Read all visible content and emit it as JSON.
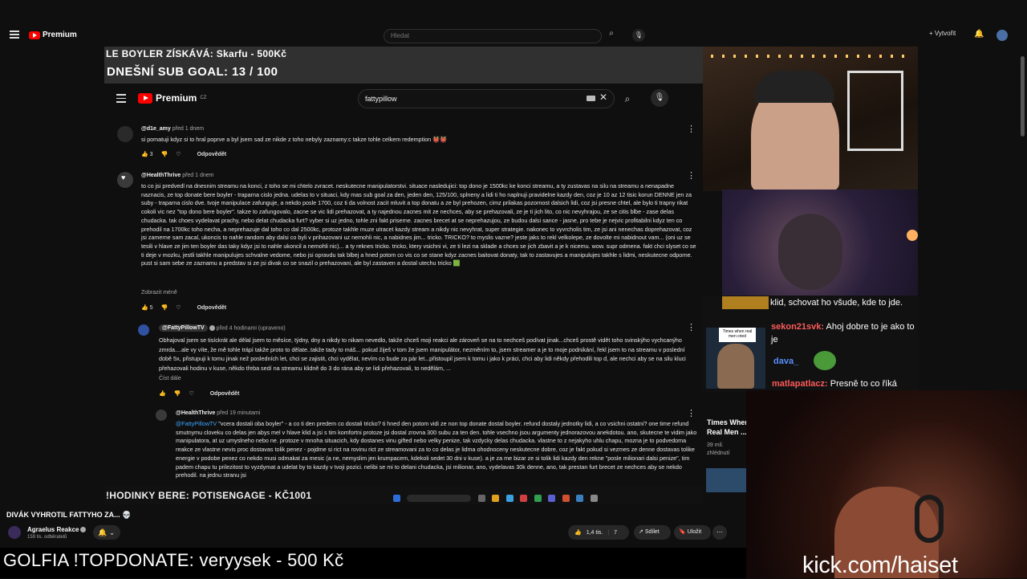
{
  "outer": {
    "logo": "Premium",
    "search_placeholder": "Hledat",
    "create": "+ Vytvořit"
  },
  "overlay": {
    "goal_line1": "LE BOYLER ZÍSKÁVÁ: Skarfu - 500Kč",
    "goal_line2": "DNEŠNÍ SUB GOAL: 13 / 100",
    "ticker": "!HODINKY BERE: POTISENGAGE - KČ1001",
    "topdonate": "GOLFIA !TOPDONATE: veryysek - 500 Kč",
    "kick": "kick.com/haiset"
  },
  "inner": {
    "logo": "Premium",
    "logo_cc": "CZ",
    "search_value": "fattypillow"
  },
  "comments": [
    {
      "handle": "@d1e_amy",
      "time": "před 1 dnem",
      "text": "si pomatuji kdyz si to hral poprve a byl jsem sad ze nikde z toho nebyly zaznamy:c takze tohle celkem redemption 👹👹",
      "likes": "3",
      "reply": "Odpovědět"
    },
    {
      "handle": "@HealthThrive",
      "time": "před 1 dnem",
      "text": "to co jsi predvedl na dnesnim streamu na konci, z toho se mi chtelo zvracet. neskutecne manipulatorstvi. situace nasledujici: top dono je 1500kc ke konci streamu, a ty zustavas na silu na streamu a nenapadne naznacis, ze top donate bere boyler - traparna cislo jedna. udelas to v situaci, kdy mas sub goal za den, jeden den, 125/100, splneny a lidi ti ho naplnuji pravidelne kazdy den, coz je 10 az 12 tisic korun DENNE jen za suby - traparna cislo dve. tvoje manipulace zafunguje, a nekdo posle 1700, coz ti da volnost zacit mluvit a top donatu a ze byl prehozen, cimz prilakas pozornost dalsich lidi, coz jsi presne chtel, ale bylo ti trapny rikat cokoli vic nez \"top dono bere boyler\". takze to zafungovalo, zacne se vic lidi prehazovat, a ty najednou zacnes mit ze nechces, aby se prehazovali, ze je ti jich lito, co nic nevyhrajou, ze se citis blbe - zase delas chudacka. tak choes vydelavat prachy, nebo delat chudacka furt? vyber si uz jedno, tohle zni fakt priserne. zacnes brecet at se neprehazujou, ze budou dalsi sance - jasne, pro tebe je nejvic profitabilni kdyz ten co prehodil na 1700kc toho necha, a neprehazuje dal toho co dal 2500kc, protoze takhle muze utracet kazdy stream a nikdy nic nevyhrat, super strategie. nakonec to vyvrcholis tim, ze jsi ani nenechas doprehazovat, coz jsi zamerne sam zacal, ukoncis to nahle random aby dalsi co byli v prihazovani uz nemohli nic, a nabidnes jim... tricko. TRICKO? to myslis vazne? jeste jaks to rekl velkolepe, ze dovolte mi nabidnout vam... (oni uz se tesili v hlave ze jim ten boyler das taky kdyz jsi to nahle ukoncil a nemohli nic)... a ty reknes tricko. tricko, ktery vsichni vi, ze ti lezi na sklade a chces se jich zbavit a je k nicemu. wow. supr odmena. fakt chci slyset co se ti deje v mozku, jestli takhle manipulujes schvalne vedome, nebo jsi opravdu tak blbej a hned potom co vis co se stane kdyz zacnes baitovat donaty, tak to zastavujes a manipulujes takhle s lidmi, neskutecne odporne. pust si sam sebe ze zaznamu a predstav si ze jsi divak co se snazil o prehazovani, ale byl zastaven a dostal utechu tricko 🟩",
      "show_less": "Zobrazit méně",
      "likes": "5",
      "reply": "Odpovědět"
    },
    {
      "handle": "@FattyPillowTV",
      "time": "před 4 hodinami (upraveno)",
      "text": "Obhajoval jsem se tisíckrát ale dělal jsem to měsíce, týdny, dny a nikdy to nikam nevedlo, takže chceš moji reakci ale zároveň se na to nechceš podívat jinak...chceš prostě vidět toho svinskýho vychcanýho zmrda....ale vy víte, že mě tohle trápí takže proto to dělate..takže tady to máš... pokud žiješ v tom že jsem manipulátor, nezměním to, jsem streamer a je to moje podnikání, řekl jsem to na streamu v poslední době 5x, přistupuji k tomu jinak než posledních let, chci se zajistit, chci vydělat, nevím co bude za pár let...přistoupil jsem k tomu i jako k práci, chci aby lidi někdy přehodili top d, ale nechci aby se na silu kluci přehazovali hodinu v kuse, někdo třeba sedí na streamu klidně do 3 do rána aby se lidi přehazovali, to nedělám, ...",
      "read_more": "Číst dále",
      "reply": "Odpovědět"
    },
    {
      "handle": "@HealthThrive",
      "time": "před 19 minutami",
      "mention": "@FattyPillowTV",
      "text": " \"vcera dostali oba boyler\" - a co ti den predem co dostali tricko? ti hned den potom vidi ze non top donate dostal boyler. refund dostaly jednotky lidi, a co vsichni ostatni? one time refund smutnymu cloveku co delas jen abys mel v hlave klid a jsi s tim komfortni protoze jsi dostal zrovna 300 subu za ten den. tohle vsechno jsou argumenty jednorazovou anekdotou. ano, skutecne te vidim jako manipulatora, at uz umyslneho nebo ne. protoze v mnoha situacich, kdy dostanes vinu gifted nebo velky penize, tak vzdycky delas chudacka. vlastne to z nejakyho uhlu chapu, mozna je to podvedoma reakce ze vlastne nevis proc dostavas tolik penez - pojdme si rict na rovinu rict ze streamovani za to co delas je lidma ohodnoceny neskutecne dobre, coz je fakt pokud si vezmes ze denne dostavas tolike energie v podobe penez co nekdo musi odmakat za mesic (a ne, nemyslim jen krumpacem, kdekoli sedet 30 dni v kuse). a je za me bizar ze si tolik lidi kazdy den rekne \"posle milionari dalsi penize\", tim padem chapu tu prilezitost to vyzdymat a udelat by to kazdy v tvoji pozici. nelibi se mi to delani chudacka, jsi milionar, ano, vydelavas 30k denne, ano, tak prestan furt brecet ze nechces aby se nekdo prehodil. na jednu stranu jsi"
    }
  ],
  "video": {
    "title": "DIVÁK VYHROTIL FATTYHO ZA... 💀",
    "channel": "Agraelus Reakce",
    "subs": "159 tis. odběratelů",
    "likes": "1,4 tis.",
    "dislikes": "7",
    "share": "Sdílet",
    "save": "Uložit"
  },
  "chat": [
    {
      "user": "",
      "text": "klid, schovat ho všude, kde to jde."
    },
    {
      "user": "sekon21svk:",
      "text": "Ahoj dobre to je ako to je",
      "color": "#ff5a5a"
    },
    {
      "user": "dava_",
      "text": "",
      "color": "#5a8dff"
    },
    {
      "user": "matlapatlacz:",
      "text": "Presně to co říká",
      "color": "#ff5a5a"
    }
  ],
  "recommended": {
    "thumb_caption": "Times when real men cried",
    "title_line1": "Times When",
    "title_line2": "Real Men ...",
    "views": "39 mil.",
    "views_label": "zhlédnutí"
  },
  "colors": {
    "youtube_red": "#ff0000",
    "mention": "#3ea6ff",
    "chat_user": "#ff5a5a"
  }
}
